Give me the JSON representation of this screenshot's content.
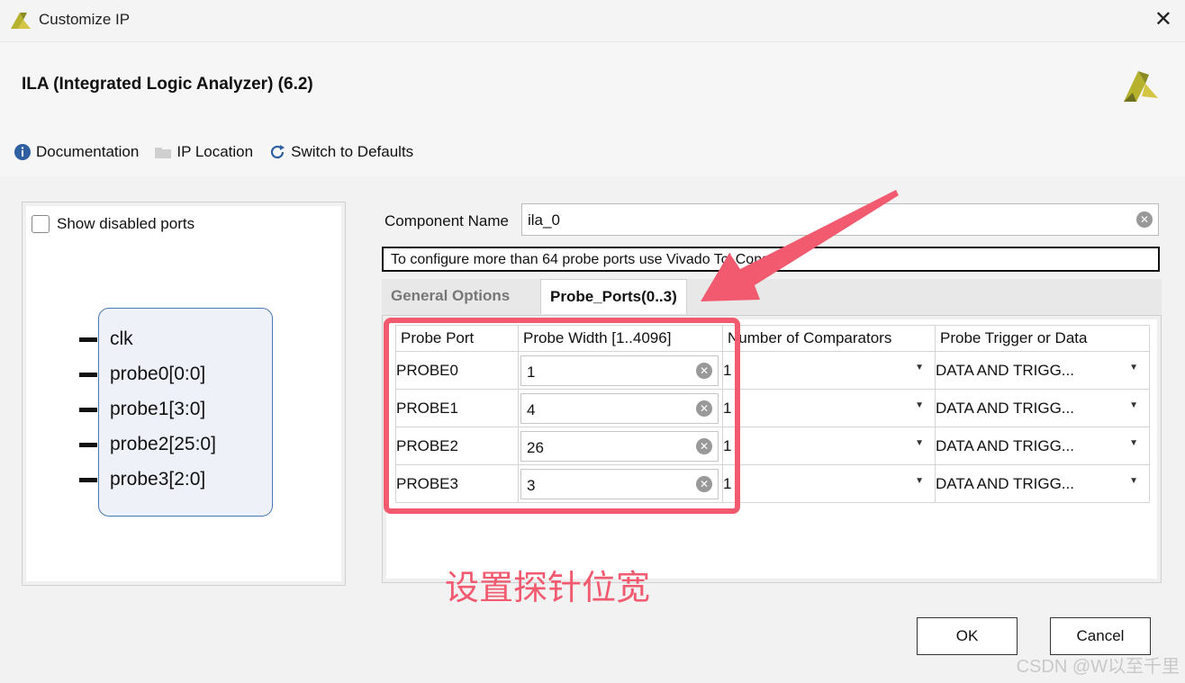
{
  "window": {
    "title": "Customize IP"
  },
  "header": {
    "ip_name": "ILA (Integrated Logic Analyzer) (6.2)"
  },
  "toolbar": {
    "documentation": "Documentation",
    "ip_location": "IP Location",
    "switch_defaults": "Switch to Defaults"
  },
  "left": {
    "show_disabled": "Show disabled ports",
    "ports": [
      "clk",
      "probe0[0:0]",
      "probe1[3:0]",
      "probe2[25:0]",
      "probe3[2:0]"
    ]
  },
  "right": {
    "component_label": "Component Name",
    "component_value": "ila_0",
    "note": "To configure more than 64 probe ports use Vivado Tcl Console",
    "tabs": [
      "General Options",
      "Probe_Ports(0..3)"
    ],
    "headers": [
      "Probe Port",
      "Probe Width [1..4096]",
      "Number of Comparators",
      "Probe Trigger or Data"
    ],
    "rows": [
      {
        "port": "PROBE0",
        "width": "1",
        "comparators": "1",
        "trigger": "DATA AND TRIGG..."
      },
      {
        "port": "PROBE1",
        "width": "4",
        "comparators": "1",
        "trigger": "DATA AND TRIGG..."
      },
      {
        "port": "PROBE2",
        "width": "26",
        "comparators": "1",
        "trigger": "DATA AND TRIGG..."
      },
      {
        "port": "PROBE3",
        "width": "3",
        "comparators": "1",
        "trigger": "DATA AND TRIGG..."
      }
    ]
  },
  "buttons": {
    "ok": "OK",
    "cancel": "Cancel"
  },
  "annotation": "设置探针位宽",
  "watermark": "CSDN @W以至千里",
  "colors": {
    "accent": "#f25a6f",
    "symbol_border": "#4a78b5"
  }
}
